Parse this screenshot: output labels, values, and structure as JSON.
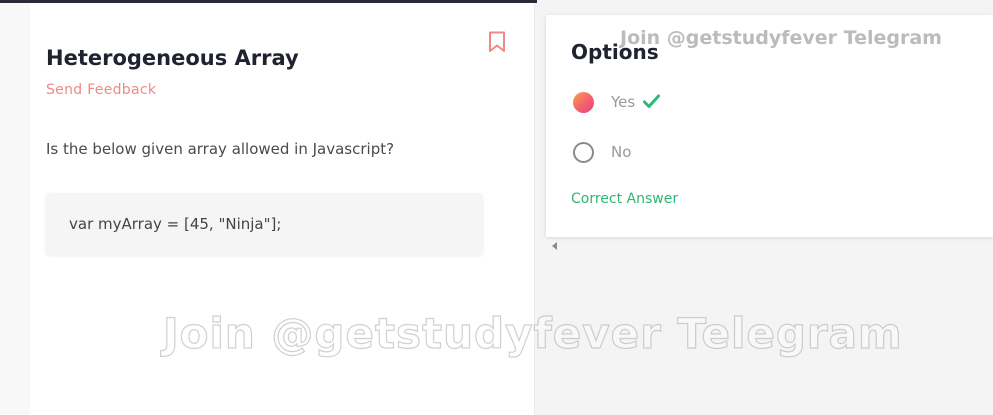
{
  "question": {
    "title": "Heterogeneous Array",
    "feedback_link": "Send Feedback",
    "text": "Is the below given array allowed in Javascript?",
    "code": "var myArray = [45, \"Ninja\"];"
  },
  "options": {
    "heading": "Options",
    "items": [
      {
        "label": "Yes",
        "selected": true,
        "correct": true
      },
      {
        "label": "No",
        "selected": false,
        "correct": false
      }
    ],
    "result_text": "Correct Answer"
  },
  "watermark": {
    "small": "Join @getstudyfever Telegram",
    "large": "Join @getstudyfever Telegram"
  },
  "colors": {
    "accent": "#f0888a",
    "success": "#2eb872",
    "title": "#1f2330"
  },
  "icons": {
    "bookmark": "bookmark-icon",
    "check": "check-icon"
  }
}
